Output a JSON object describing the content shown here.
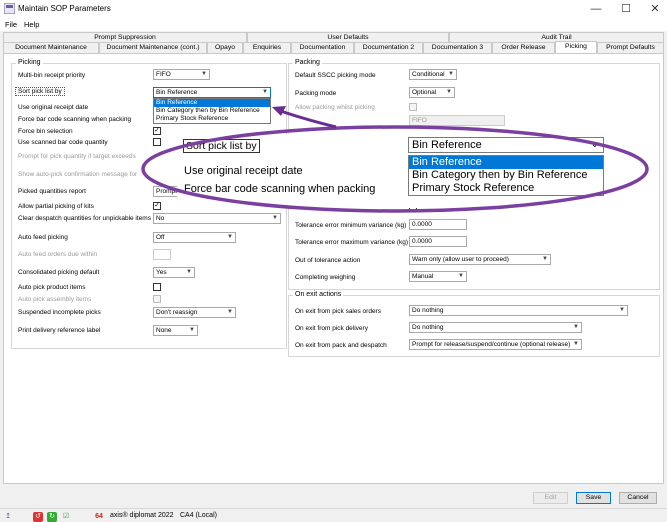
{
  "window": {
    "title": "Maintain SOP Parameters",
    "minimize": "—",
    "maximize": "☐",
    "close": "✕"
  },
  "menu": [
    "File",
    "Help"
  ],
  "tabs_row1": [
    "Prompt Suppression",
    "User Defaults",
    "Audit Trail"
  ],
  "tabs_row2": [
    "Document Maintenance",
    "Document Maintenance (cont.)",
    "Opayo",
    "Enquiries",
    "Documentation",
    "Documentation 2",
    "Documentation 3",
    "Order Release",
    "Picking",
    "Prompt Defaults"
  ],
  "picking": {
    "title": "Picking",
    "multibin_label": "Multi-bin receipt priority",
    "multibin_value": "FIFO",
    "sort_label": "Sort pick list by",
    "sort_value": "Bin Reference",
    "sort_options": [
      "Bin Reference",
      "Bin Category then by Bin Reference",
      "Primary Stock Reference"
    ],
    "use_orig_label": "Use original receipt date",
    "force_bar_label": "Force bar code scanning when packing",
    "force_bin_label": "Force bin selection",
    "force_bin_checked": "✓",
    "use_scanned_label": "Use scanned bar code quantity",
    "prompt_qty_label": "Prompt for pick quantity if target exceeds",
    "show_auto_label": "Show auto-pick confirmation message for",
    "picked_report_label": "Picked quantities report",
    "picked_report_value": "Prompt on...",
    "allow_partial_label": "Allow partial picking of kits",
    "allow_partial_checked": "✓",
    "clear_despatch_label": "Clear despatch quantities for unpickable items",
    "clear_despatch_value": "No",
    "auto_feed_label": "Auto feed picking",
    "auto_feed_value": "Off",
    "auto_feed_orders_label": "Auto feed orders due within",
    "consolidated_label": "Consolidated picking default",
    "consolidated_value": "Yes",
    "auto_pick_product_label": "Auto pick product items",
    "auto_pick_assembly_label": "Auto pick assembly items",
    "suspended_label": "Suspended incomplete picks",
    "suspended_value": "Don't reassign",
    "print_delivery_label": "Print delivery reference label",
    "print_delivery_value": "None"
  },
  "packing": {
    "title": "Packing",
    "sscc_label": "Default SSCC picking mode",
    "sscc_value": "Conditional",
    "mode_label": "Packing mode",
    "mode_value": "Optional",
    "allow_whilst_label": "Allow packing whilst picking",
    "fifo_value": "FIFO",
    "tol_min_label": "Tolerance error minimum variance (kg)",
    "tol_min_value": "0.0000",
    "tol_max_label": "Tolerance error maximum variance (kg)",
    "tol_max_value": "0.0000",
    "out_tol_label": "Out of tolerance action",
    "out_tol_value": "Warn only (allow user to proceed)",
    "completing_label": "Completing weighing",
    "completing_value": "Manual"
  },
  "on_exit": {
    "title": "On exit actions",
    "sales_label": "On exit from pick sales orders",
    "sales_value": "Do nothing",
    "delivery_label": "On exit from pick delivery",
    "delivery_value": "Do nothing",
    "pack_label": "On exit from pack and despatch",
    "pack_value": "Prompt for release/suspend/continue (optional release)"
  },
  "zoom": {
    "sort_label": "Sort pick list by",
    "use_orig_label": "Use original receipt date",
    "force_bar_label": "Force bar code scanning when packing",
    "value": "Bin Reference",
    "options": [
      "Bin Reference",
      "Bin Category then by Bin Reference",
      "Primary Stock Reference"
    ]
  },
  "buttons": {
    "edit": "Edit",
    "save": "Save",
    "cancel": "Cancel"
  },
  "status": {
    "product": "axis® diplomat 2022",
    "company": "CA4 (Local)"
  },
  "colors": {
    "highlight": "#0078d7",
    "ellipse": "#7b3fa0",
    "arrow": "#6a2c91"
  }
}
